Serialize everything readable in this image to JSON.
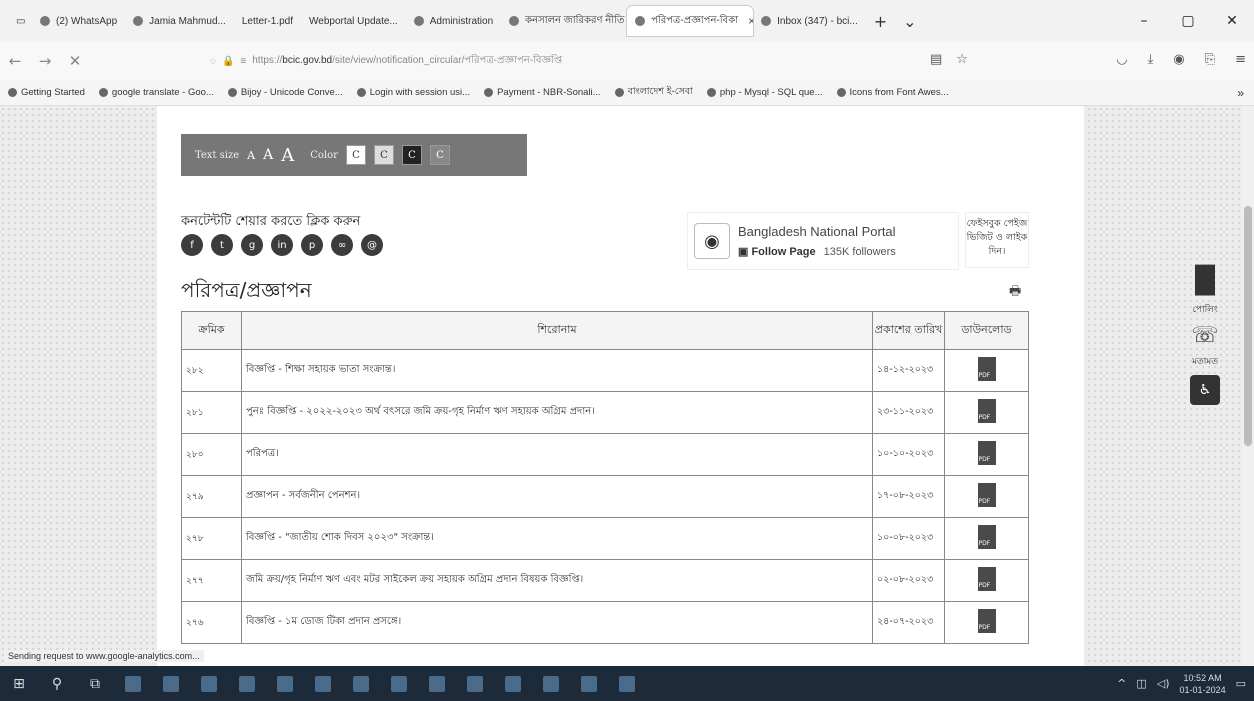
{
  "browser": {
    "tabs": [
      {
        "label": "(2) WhatsApp",
        "active": false
      },
      {
        "label": "Jamia Mahmud...",
        "active": false
      },
      {
        "label": "Letter-1.pdf",
        "active": false
      },
      {
        "label": "Webportal Update...",
        "active": false
      },
      {
        "label": "Administration",
        "active": false
      },
      {
        "label": "কনসালন জারিকরণ নীতি",
        "active": false
      },
      {
        "label": "পরিপত্র-প্রজ্ঞাপন-বিকা",
        "active": true
      },
      {
        "label": "Inbox (347) - bci...",
        "active": false
      }
    ],
    "url_prefix": "https://",
    "url_host": "bcic.gov.bd",
    "url_path": "/site/view/notification_circular/পরিপত্র-প্রজ্ঞাপন-বিজ্ঞপ্তি",
    "bookmarks": [
      "Getting Started",
      "google translate - Goo...",
      "Bijoy - Unicode Conve...",
      "Login with session usi...",
      "Payment - NBR-Sonali...",
      "বাংলাদেশ ই-সেবা",
      "php - Mysql - SQL que...",
      "Icons from Font Awes..."
    ],
    "status_text": "Sending request to www.google-analytics.com..."
  },
  "toolbar": {
    "text_size_label": "Text size",
    "a_small": "A",
    "a_medium": "A",
    "a_large": "A",
    "color_label": "Color",
    "color_buttons": [
      "C",
      "C",
      "C",
      "C"
    ]
  },
  "share": {
    "label": "কনটেন্টটি শেয়ার করতে ক্লিক করুন",
    "icons": [
      "facebook-icon",
      "twitter-icon",
      "google-plus-icon",
      "linkedin-icon",
      "pinterest-icon",
      "link-icon",
      "email-icon"
    ]
  },
  "portal": {
    "name": "Bangladesh National Portal",
    "follow": "Follow Page",
    "followers": "135K followers",
    "fb_note": "ফেইসবুক পেইজ ভিজিট ও লাইক দিন।"
  },
  "page_title": "পরিপত্র/প্রজ্ঞাপন",
  "table": {
    "headers": [
      "ক্রমিক",
      "শিরোনাম",
      "প্রকাশের তারিখ",
      "ডাউনলোড"
    ],
    "rows": [
      {
        "num": "২৮২",
        "title": "বিজ্ঞপ্তি - শিক্ষা সহায়ক ভাতা সংক্রান্ত।",
        "date": "১৪-১২-২০২৩"
      },
      {
        "num": "২৮১",
        "title": "পুনঃ বিজ্ঞপ্তি - ২০২২-২০২৩ অর্থ বৎসরে জমি ক্রয়-গৃহ নির্মাণ ঋণ সহায়ক অগ্রিম প্রদান।",
        "date": "২৩-১১-২০২৩"
      },
      {
        "num": "২৮০",
        "title": "পরিপত্র।",
        "date": "১০-১০-২০২৩"
      },
      {
        "num": "২৭৯",
        "title": "প্রজ্ঞাপন - সর্বজনীন পেনশন।",
        "date": "১৭-০৮-২০২৩"
      },
      {
        "num": "২৭৮",
        "title": "বিজ্ঞপ্তি - \"জাতীয় শোক দিবস ২০২৩\" সংক্রান্ত।",
        "date": "১০-০৮-২০২৩"
      },
      {
        "num": "২৭৭",
        "title": "জমি ক্রয়/গৃহ নির্মাণ ঋণ এবং মটর সাইকেল ক্রয় সহায়ক অগ্রিম প্রদান বিষয়ক বিজ্ঞপ্তি।",
        "date": "০২-০৮-২০২৩"
      },
      {
        "num": "২৭৬",
        "title": "বিজ্ঞপ্তি - ১ম ডোজ টিকা প্রদান প্রসঙ্গে।",
        "date": "২৪-০৭-২০২৩"
      }
    ]
  },
  "side_widget": {
    "stats_label": "পোলিং",
    "feedback_label": "মতামত"
  },
  "taskbar": {
    "time": "10:52 AM",
    "date": "01-01-2024"
  }
}
